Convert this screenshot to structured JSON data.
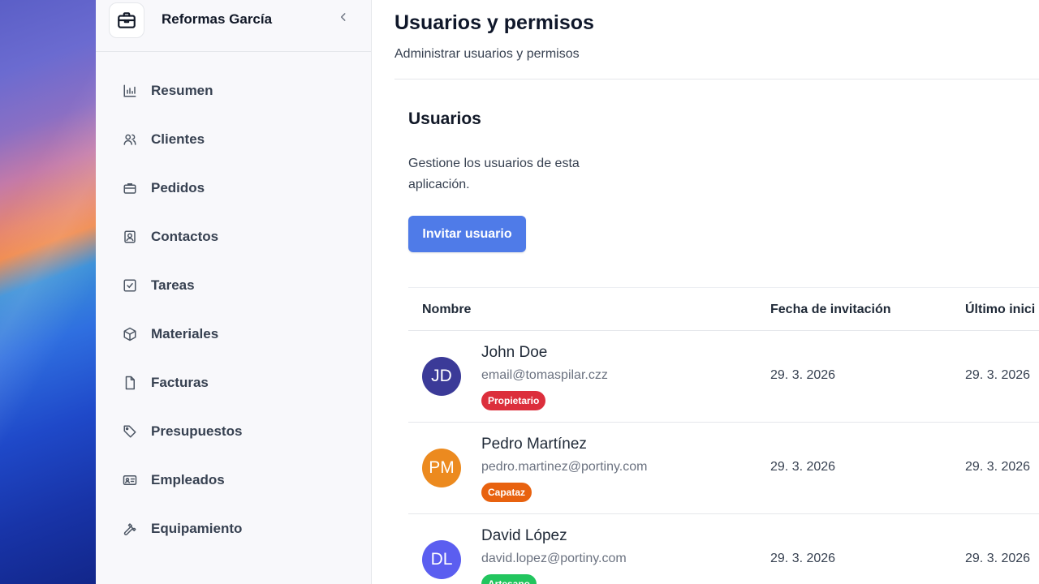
{
  "sidebar": {
    "company_name": "Reformas García",
    "logo_icon": "briefcase-icon",
    "collapse_icon": "chevron-left-icon",
    "items": [
      {
        "label": "Resumen",
        "icon": "bar-chart-icon"
      },
      {
        "label": "Clientes",
        "icon": "users-icon"
      },
      {
        "label": "Pedidos",
        "icon": "briefcase-icon"
      },
      {
        "label": "Contactos",
        "icon": "contact-book-icon"
      },
      {
        "label": "Tareas",
        "icon": "checkbox-icon"
      },
      {
        "label": "Materiales",
        "icon": "box-icon"
      },
      {
        "label": "Facturas",
        "icon": "file-icon"
      },
      {
        "label": "Presupuestos",
        "icon": "tag-icon"
      },
      {
        "label": "Empleados",
        "icon": "id-card-icon"
      },
      {
        "label": "Equipamiento",
        "icon": "wrench-icon"
      }
    ]
  },
  "header": {
    "title": "Usuarios y permisos",
    "subtitle": "Administrar usuarios y permisos"
  },
  "users_section": {
    "title": "Usuarios",
    "description": "Gestione los usuarios de esta aplicación.",
    "invite_label": "Invitar usuario"
  },
  "table": {
    "columns": [
      "Nombre",
      "Fecha de invitación",
      "Último inici"
    ],
    "rows": [
      {
        "initials": "JD",
        "name": "John Doe",
        "email": "email@tomaspilar.czz",
        "role": "Propietario",
        "invited": "29. 3. 2026",
        "last_login": "29. 3. 2026",
        "avatar_color": "#3b3a98",
        "role_color": "#dc2f3c"
      },
      {
        "initials": "PM",
        "name": "Pedro Martínez",
        "email": "pedro.martinez@portiny.com",
        "role": "Capataz",
        "invited": "29. 3. 2026",
        "last_login": "29. 3. 2026",
        "avatar_color": "#ec8a1f",
        "role_color": "#e8620f"
      },
      {
        "initials": "DL",
        "name": "David López",
        "email": "david.lopez@portiny.com",
        "role": "Artesano",
        "invited": "29. 3. 2026",
        "last_login": "29. 3. 2026",
        "avatar_color": "#5b5ef0",
        "role_color": "#22c55e"
      }
    ]
  },
  "colors": {
    "accent": "#4f7be8",
    "sidebar_bg": "#f8f8fb"
  }
}
